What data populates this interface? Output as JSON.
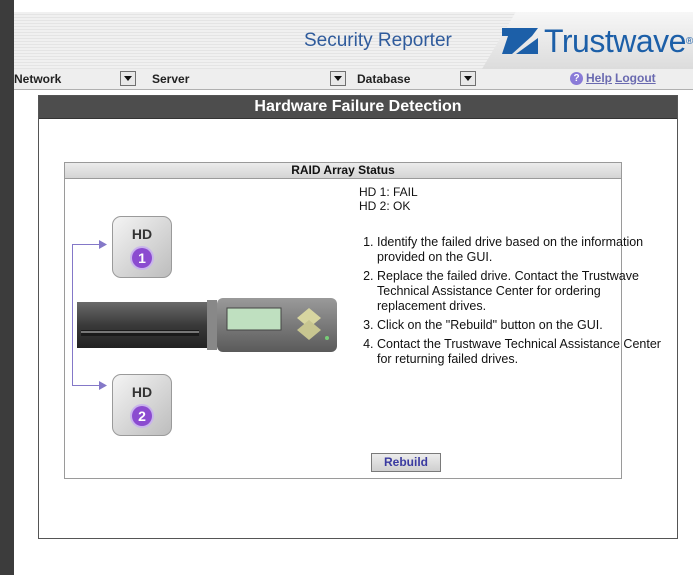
{
  "header": {
    "product_name": "Security Reporter",
    "brand_name": "Trustwave",
    "brand_mark": "®"
  },
  "menubar": {
    "network": "Network",
    "server": "Server",
    "database": "Database",
    "help": "Help",
    "logout": "Logout"
  },
  "window": {
    "title": "Hardware Failure Detection"
  },
  "raid_panel": {
    "title": "RAID Array Status",
    "hd1_status": "HD 1: FAIL",
    "hd2_status": "HD 2: OK",
    "drive1_label": "HD",
    "drive1_number": "1",
    "drive2_label": "HD",
    "drive2_number": "2",
    "steps": [
      "Identify the failed drive based on the information provided on the GUI.",
      "Replace the failed drive. Contact the Trustwave Technical Assistance Center for ordering replacement drives.",
      "Click on the \"Rebuild\" button on the GUI.",
      "Contact the Trustwave Technical Assistance Center for returning failed drives."
    ],
    "rebuild_label": "Rebuild"
  },
  "colors": {
    "title_bar": "#4d4d4d",
    "brand_blue": "#1c5fa8",
    "drive_badge": "#8b4bd0"
  }
}
